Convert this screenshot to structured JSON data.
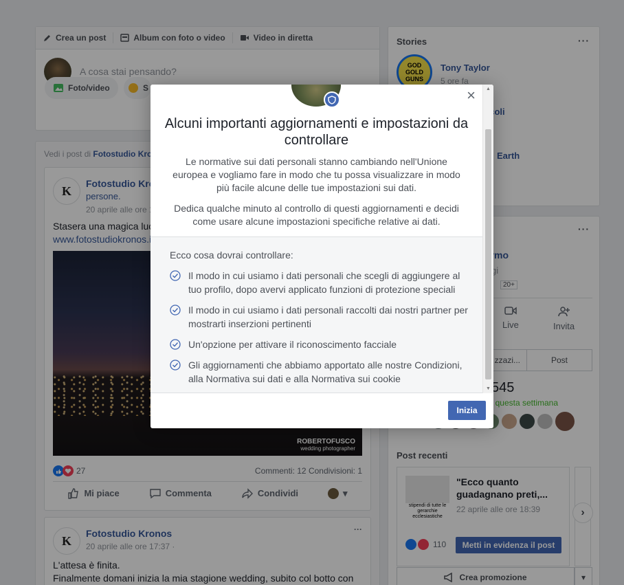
{
  "composer": {
    "tabs": [
      "Crea un post",
      "Album con foto o video",
      "Video in diretta"
    ],
    "placeholder": "A cosa stai pensando?",
    "photo_btn": "Foto/video",
    "second_btn": "S"
  },
  "feed": {
    "header_prefix": "Vedi i post di",
    "header_page": "Fotostudio Kro",
    "post1": {
      "page": "Fotostudio Kro",
      "sub": "persone.",
      "time": "20 aprile alle ore 1",
      "text": "Stasera una magica luc",
      "link": "www.fotostudiokronos.i",
      "watermark1": "ROBERTOFUSCO",
      "watermark2": "wedding photographer",
      "reactions": "27",
      "comments": "Commenti: 12",
      "shares": "Condivisioni: 1",
      "like": "Mi piace",
      "comment": "Commenta",
      "share": "Condividi"
    },
    "post2": {
      "page": "Fotostudio Kronos",
      "time": "20 aprile alle ore 17:37 ·",
      "line1": "L'attesa è finita.",
      "line2": "Finalmente domani inizia la mia stagione wedding, subito col botto con"
    }
  },
  "right": {
    "stories_title": "Stories",
    "story1_name": "Tony Taylor",
    "story1_time": "5 ore fa",
    "story1_ring_text": "GOD GOLD GUNS",
    "story2_name": "ccoli",
    "story3_name": "Earth",
    "page_name": "ormo",
    "page_sub": "gi",
    "page_badge": "20+",
    "live": "Live",
    "invite": "Invita",
    "tab1": "zzazi...",
    "tab2": "Post",
    "likes_num": "545",
    "likes_week": "' questa settimana",
    "recent_title": "Post recenti",
    "recent_text": "\"Ecco quanto guadagnano preti,...",
    "recent_date": "22 aprile alle ore 18:39",
    "recent_count": "110",
    "boost": "Metti in evidenza il post",
    "promo": "Crea promozione",
    "thumb_text": "stipendi di tutte le gerarchie ecclesiastiche"
  },
  "modal": {
    "title": "Alcuni importanti aggiornamenti e impostazioni da controllare",
    "p1": "Le normative sui dati personali stanno cambiando nell'Unione europea e vogliamo fare in modo che tu possa visualizzare in modo più facile alcune delle tue impostazioni sui dati.",
    "p2": "Dedica qualche minuto al controllo di questi aggiornamenti e decidi come usare alcune impostazioni specifiche relative ai dati.",
    "checklist_title": "Ecco cosa dovrai controllare:",
    "items": [
      "Il modo in cui usiamo i dati personali che scegli di aggiungere al tuo profilo, dopo avervi applicato funzioni di protezione speciali",
      "Il modo in cui usiamo i dati personali raccolti dai nostri partner per mostrarti inserzioni pertinenti",
      "Un'opzione per attivare il riconoscimento facciale",
      "Gli aggiornamenti che abbiamo apportato alle nostre Condizioni, alla Normativa sui dati e alla Normativa sui cookie"
    ],
    "start_button": "Inizia"
  },
  "colors": {
    "accent": "#4267b2",
    "background": "#e9ebee",
    "check": "#4267b2"
  }
}
